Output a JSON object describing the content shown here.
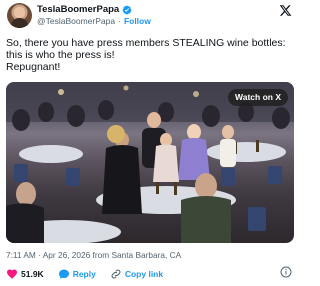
{
  "author": {
    "display_name": "TeslaBoomerPapa",
    "handle": "@TeslaBoomerPapa",
    "separator": "·",
    "follow_label": "Follow"
  },
  "post": {
    "text_lines": [
      "So, there you have press members STEALING wine bottles:",
      "this is who the press is!",
      "Repugnant!"
    ]
  },
  "media": {
    "watch_label": "Watch on X"
  },
  "meta": {
    "timestamp": "7:11 AM · Apr 26, 2026 from Santa Barbara, CA"
  },
  "actions": {
    "likes": "51.9K",
    "reply_label": "Reply",
    "copy_link_label": "Copy link"
  },
  "colors": {
    "accent": "#1d9bf0",
    "like": "#f91880",
    "verified": "#1d9bf0",
    "text": "#0f1419",
    "muted": "#536471"
  },
  "icons": [
    "verified-badge-icon",
    "x-logo-icon",
    "heart-icon",
    "reply-icon",
    "link-icon",
    "info-icon"
  ]
}
